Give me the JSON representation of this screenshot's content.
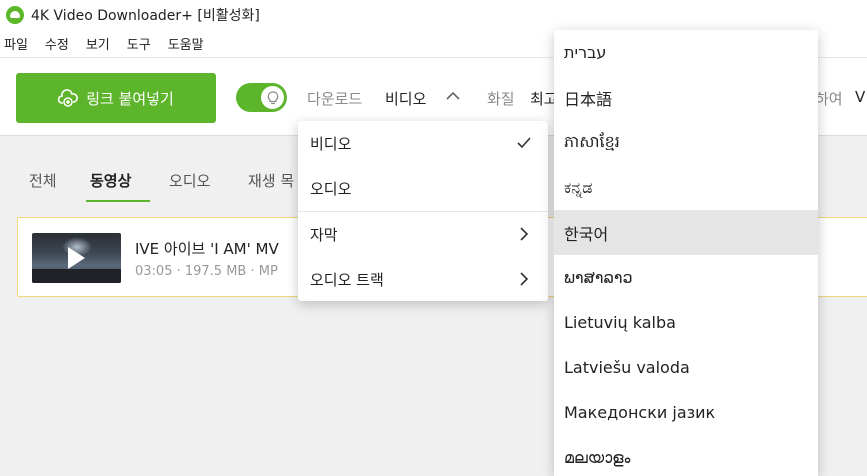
{
  "window": {
    "title": "4K Video Downloader+ [비활성화]"
  },
  "menubar": {
    "items": [
      "파일",
      "수정",
      "보기",
      "도구",
      "도움말"
    ]
  },
  "toolbar": {
    "paste_button": "링크 붙여넣기",
    "smart_mode_on": true,
    "download_label": "다운로드",
    "download_value": "비디오",
    "quality_label": "화질",
    "quality_value": "최고",
    "save_label": "하여",
    "save_value": "V"
  },
  "tabs": [
    "전체",
    "동영상",
    "오디오",
    "재생 목"
  ],
  "active_tab": "동영상",
  "download_item": {
    "title": "IVE 아이브 'I AM' MV",
    "meta": "03:05 · 197.5 MB · MP"
  },
  "download_menu": {
    "items": [
      {
        "label": "비디오",
        "icon": "check-icon"
      },
      {
        "label": "오디오",
        "icon": ""
      },
      {
        "label": "자막",
        "icon": "chevron-right-icon"
      },
      {
        "label": "오디오 트랙",
        "icon": "chevron-right-icon"
      }
    ]
  },
  "language_list": {
    "items": [
      "עברית",
      "日本語",
      "ភាសាខ្មែរ",
      "ಕನ್ನಡ",
      "한국어",
      "ພາສາລາວ",
      "Lietuvių kalba",
      "Latviešu valoda",
      "Македонски јазик",
      "മലയാളം"
    ],
    "selected": "한국어"
  },
  "colors": {
    "accent": "#5db52c",
    "card_border": "#f2d67a"
  }
}
